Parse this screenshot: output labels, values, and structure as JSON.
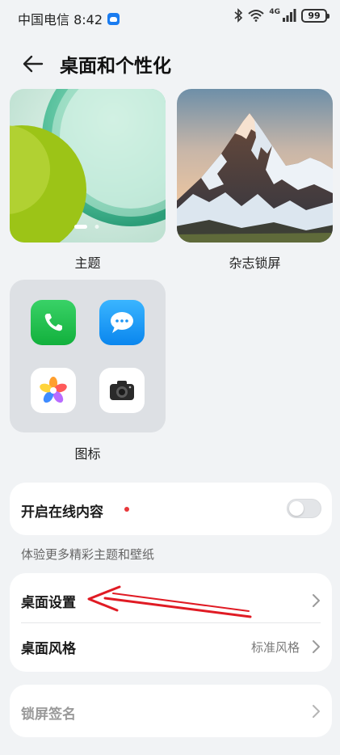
{
  "status_bar": {
    "carrier_time": "中国电信 8:42",
    "network": "4G",
    "battery": "99"
  },
  "header": {
    "title": "桌面和个性化"
  },
  "cards": {
    "theme_label": "主题",
    "magazine_label": "杂志锁屏",
    "icons_label": "图标"
  },
  "online_content": {
    "label": "开启在线内容",
    "toggle_on": false
  },
  "hint_text": "体验更多精彩主题和壁纸",
  "settings": {
    "desktop_settings_label": "桌面设置",
    "desktop_style_label": "桌面风格",
    "desktop_style_value": "标准风格"
  },
  "lock_signature": {
    "label": "锁屏签名"
  },
  "colors": {
    "accent_red": "#e8373a",
    "background": "#f1f3f5"
  }
}
